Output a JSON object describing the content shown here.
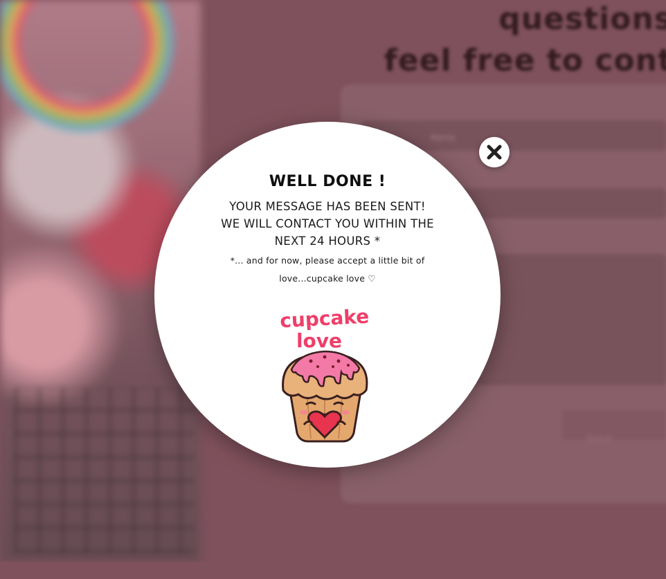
{
  "background": {
    "heading_line_1": "questions",
    "heading_line_2": "feel free to cont",
    "field_label": "Name",
    "send_label": "Send"
  },
  "modal": {
    "title": "WELL DONE !",
    "message_lines": [
      "YOUR MESSAGE HAS BEEN SENT!",
      "WE WILL CONTACT YOU WITHIN THE",
      "NEXT 24 HOURS *"
    ],
    "note_lines": [
      "*... and for now, please accept a little bit of",
      "love...cupcake love ♡"
    ],
    "image": {
      "caption_line_1": "cupcake",
      "caption_line_2": "love",
      "icon": "cupcake-icon"
    },
    "close_icon": "close-icon"
  },
  "colors": {
    "overlay": "#7a5660",
    "modal_bg": "#ffffff",
    "cupcake_pink": "#ee3f69",
    "frosting": "#f37aa6",
    "muffin": "#e4a86e"
  }
}
